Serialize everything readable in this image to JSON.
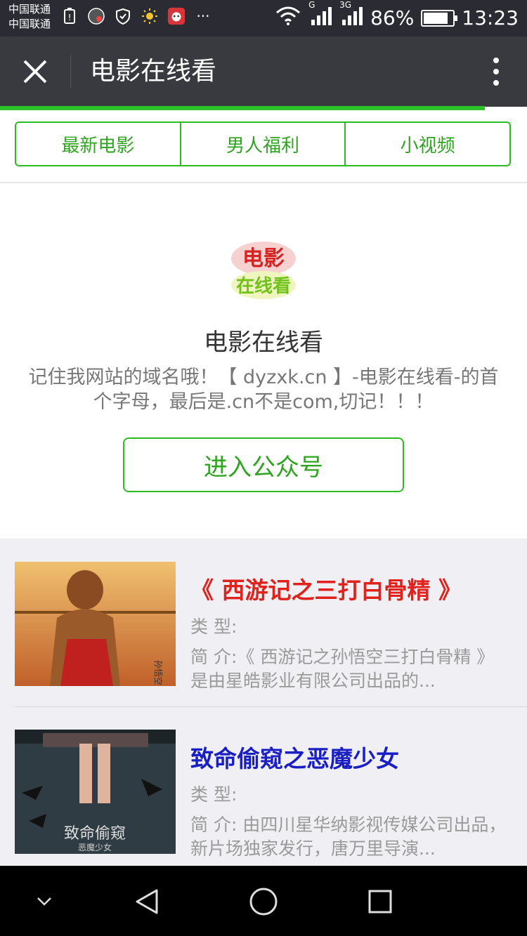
{
  "status_bar": {
    "carrier_1": "中国联通",
    "carrier_2": "中国联通",
    "signal_1_label": "G",
    "signal_2_label": "3G",
    "battery": "86%",
    "time": "13:23",
    "more": "···"
  },
  "title_bar": {
    "title": "电影在线看",
    "close_icon": "close-icon",
    "more_icon": "more-vertical-icon"
  },
  "tabs": [
    {
      "label": "最新电影"
    },
    {
      "label": "男人福利"
    },
    {
      "label": "小视频"
    }
  ],
  "account": {
    "logo_line_1": "电影",
    "logo_line_2": "在线看",
    "name": "电影在线看",
    "description": "记住我网站的域名哦！【 dyzxk.cn 】-电影在线看-的首个字母，最后是.cn不是com,切记！！！",
    "enter_button": "进入公众号"
  },
  "movies": [
    {
      "title": "《 西游记之三打白骨精 》",
      "type_label": "类 型:",
      "description": "简 介:《 西游记之孙悟空三打白骨精 》是由星皓影业有限公司出品的...",
      "title_color": "#e0211c",
      "poster_text": "孙悟空"
    },
    {
      "title": "致命偷窥之恶魔少女",
      "type_label": "类 型:",
      "description": "简 介: 由四川星华纳影视传媒公司出品，新片场独家发行，唐万里导演...",
      "title_color": "#1a1fc4",
      "poster_text": "致命偷窥",
      "poster_sub": "恶魔少女"
    }
  ],
  "colors": {
    "accent_green": "#2dbb22",
    "titlebar": "#393a3f",
    "statusbar": "#2b2b33"
  }
}
